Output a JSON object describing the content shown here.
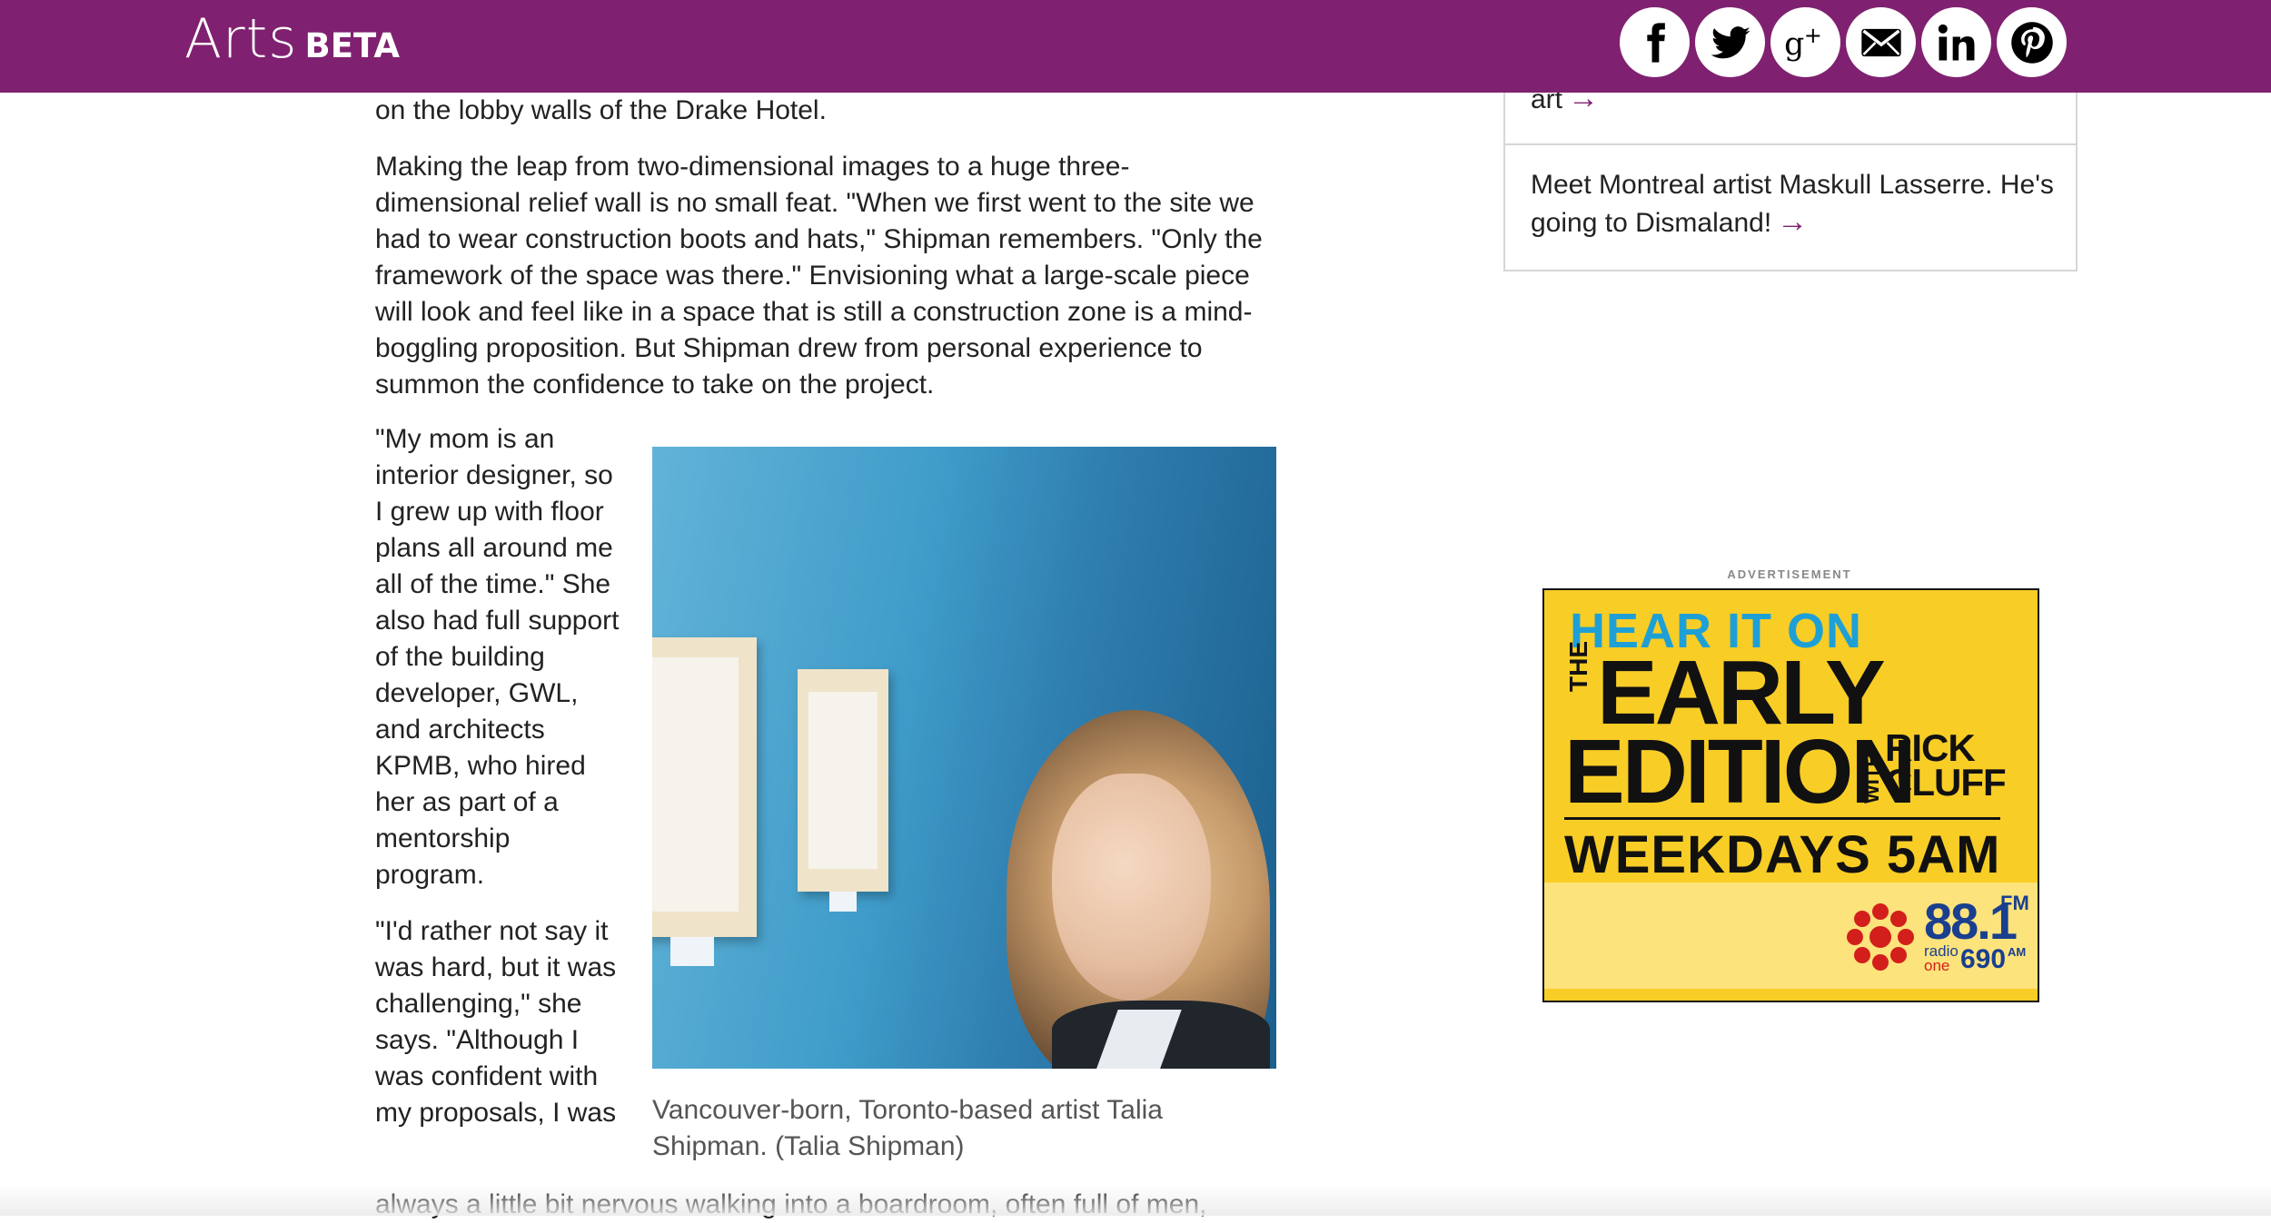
{
  "header": {
    "brand": "Arts",
    "badge": "BETA",
    "share_icons": [
      "facebook-icon",
      "twitter-icon",
      "google-plus-icon",
      "email-icon",
      "linkedin-icon",
      "pinterest-icon"
    ]
  },
  "article": {
    "para_top": "on the lobby walls of the Drake Hotel.",
    "para_2": "Making the leap from two-dimensional images to a huge three-dimensional relief wall is no small feat. \"When we first went to the site we had to wear construction boots and hats,\" Shipman remembers. \"Only the framework of the space was there.\" Envisioning what a large-scale piece will look and feel like in a space that is still a construction zone is a mind-boggling proposition. But Shipman drew from personal experience to summon the confidence to take on the project.",
    "para_3": "\"My mom is an interior designer, so I grew up with floor plans all around me all of the time.\" She also had full support of the building developer, GWL, and architects KPMB, who hired her as part of a mentorship program.",
    "para_4": "\"I'd rather not say it was hard, but it was challenging,\" she says. \"Although I was confident with my proposals, I was",
    "para_4_tail": "always a little bit nervous walking into a boardroom, often full of men,",
    "figure_caption": "Vancouver-born, Toronto-based artist Talia Shipman. (Talia Shipman)"
  },
  "sidebar": {
    "item1": "art",
    "item2": "Meet Montreal artist Maskull Lasserre. He's going to Dismaland!"
  },
  "ad": {
    "label": "ADVERTISEMENT",
    "hear": "HEAR IT ON",
    "the": "THE",
    "early": "EARLY",
    "edition": "EDITION",
    "with": "WITH",
    "rick": "RICK",
    "cluff": "CLUFF",
    "weekdays": "WEEKDAYS 5AM",
    "freq": "88.1",
    "fm": "FM",
    "radio": "radio",
    "one": "one",
    "am": "690",
    "amtxt": "AM"
  },
  "colors": {
    "header_bg": "#7f2170",
    "ad_yellow": "#f8cd26",
    "ad_blue_text": "#1ea0d6",
    "cbc_red": "#d21f1b"
  }
}
